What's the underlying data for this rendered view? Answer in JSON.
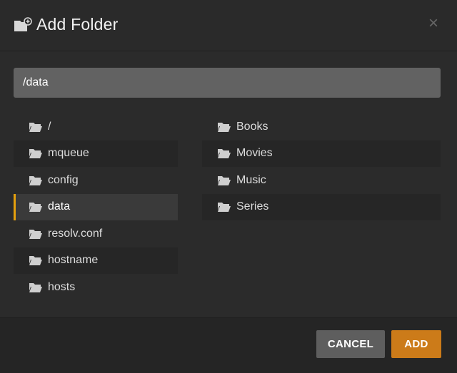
{
  "dialog": {
    "title": "Add Folder",
    "header_icon": "folder-add-icon",
    "close_icon": "close-icon",
    "close_glyph": "×"
  },
  "path_input": {
    "value": "/data"
  },
  "left_list": [
    {
      "label": "/"
    },
    {
      "label": "mqueue"
    },
    {
      "label": "config"
    },
    {
      "label": "data"
    },
    {
      "label": "resolv.conf"
    },
    {
      "label": "hostname"
    },
    {
      "label": "hosts"
    }
  ],
  "right_list": [
    {
      "label": "Books"
    },
    {
      "label": "Movies"
    },
    {
      "label": "Music"
    },
    {
      "label": "Series"
    }
  ],
  "selected_left_index": 3,
  "footer": {
    "cancel_label": "CANCEL",
    "add_label": "ADD"
  },
  "colors": {
    "accent": "#e5a00d",
    "add_button": "#cc7b19",
    "cancel_button": "#5e5e5e",
    "input_bg": "#626262",
    "background": "#2b2b2b"
  }
}
